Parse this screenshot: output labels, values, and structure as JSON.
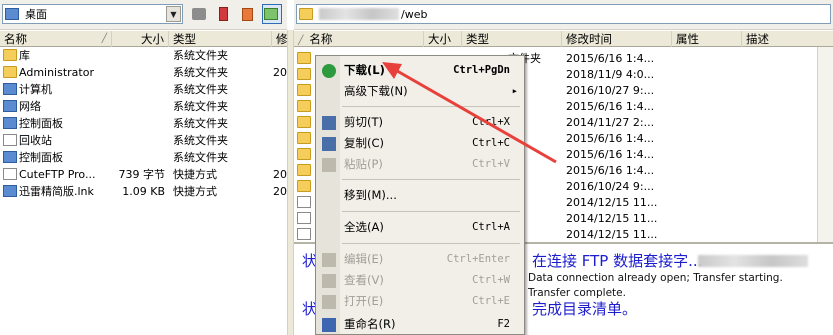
{
  "local_toolbar": {
    "path": "桌面"
  },
  "remote_toolbar": {
    "path_suffix": "/web"
  },
  "local_headers": [
    "名称",
    "大小",
    "类型",
    "修"
  ],
  "remote_headers": [
    "名称",
    "大小",
    "类型",
    "修改时间",
    "属性",
    "描述"
  ],
  "local_items": [
    {
      "name": "库",
      "size": "",
      "type": "系统文件夹",
      "mod": "",
      "icon": "folder"
    },
    {
      "name": "Administrator",
      "size": "",
      "type": "系统文件夹",
      "mod": "20",
      "icon": "folder"
    },
    {
      "name": "计算机",
      "size": "",
      "type": "系统文件夹",
      "mod": "",
      "icon": "blue"
    },
    {
      "name": "网络",
      "size": "",
      "type": "系统文件夹",
      "mod": "",
      "icon": "blue"
    },
    {
      "name": "控制面板",
      "size": "",
      "type": "系统文件夹",
      "mod": "",
      "icon": "blue"
    },
    {
      "name": "回收站",
      "size": "",
      "type": "系统文件夹",
      "mod": "",
      "icon": "file"
    },
    {
      "name": "控制面板",
      "size": "",
      "type": "系统文件夹",
      "mod": "",
      "icon": "blue"
    },
    {
      "name": "CuteFTP Pro...",
      "size": "739 字节",
      "type": "快捷方式",
      "mod": "20",
      "icon": "file"
    },
    {
      "name": "迅雷精简版.lnk",
      "size": "1.09 KB",
      "type": "快捷方式",
      "mod": "20",
      "icon": "blue"
    }
  ],
  "remote_items": [
    {
      "type": "文件夹",
      "mod": "2015/6/16 1:4...",
      "icon": "folder"
    },
    {
      "type": "",
      "mod": "2018/11/9 4:0...",
      "icon": "folder"
    },
    {
      "type": "",
      "mod": "2016/10/27 9:...",
      "icon": "folder"
    },
    {
      "type": "",
      "mod": "2015/6/16 1:4...",
      "icon": "folder"
    },
    {
      "type": "",
      "mod": "2014/11/27 2:...",
      "icon": "folder"
    },
    {
      "type": "",
      "mod": "2015/6/16 1:4...",
      "icon": "folder"
    },
    {
      "type": "",
      "mod": "2015/6/16 1:4...",
      "icon": "folder"
    },
    {
      "type": "",
      "mod": "2015/6/16 1:4...",
      "icon": "folder"
    },
    {
      "type": "",
      "mod": "2016/10/24 9:...",
      "icon": "folder"
    },
    {
      "type": "",
      "mod": "2014/12/15 11...",
      "icon": "file"
    },
    {
      "type": "",
      "mod": "2014/12/15 11...",
      "icon": "file"
    },
    {
      "type": "",
      "mod": "2014/12/15 11...",
      "icon": "file"
    }
  ],
  "log": {
    "line1_prefix": "状",
    "line1": "在连接 FTP 数据套接字...",
    "line2": "Data connection already open; Transfer starting.",
    "line3": "Transfer complete.",
    "line4_prefix": "状",
    "line4": "完成目录清单。"
  },
  "context_menu": [
    {
      "label": "下载(L)",
      "shortcut": "Ctrl+PgDn",
      "enabled": true,
      "bold": true,
      "icon": "download-icon"
    },
    {
      "label": "高级下载(N)",
      "shortcut": "",
      "enabled": true,
      "submenu": true
    },
    {
      "label": "剪切(T)",
      "shortcut": "Ctrl+X",
      "enabled": true,
      "icon": "cut-icon"
    },
    {
      "label": "复制(C)",
      "shortcut": "Ctrl+C",
      "enabled": true,
      "icon": "copy-icon"
    },
    {
      "label": "粘贴(P)",
      "shortcut": "Ctrl+V",
      "enabled": false,
      "icon": "paste-icon"
    },
    {
      "label": "移到(M)...",
      "shortcut": "",
      "enabled": true
    },
    {
      "label": "全选(A)",
      "shortcut": "Ctrl+A",
      "enabled": true
    },
    {
      "label": "编辑(E)",
      "shortcut": "Ctrl+Enter",
      "enabled": false,
      "icon": "edit-icon"
    },
    {
      "label": "查看(V)",
      "shortcut": "Ctrl+W",
      "enabled": false,
      "icon": "view-icon"
    },
    {
      "label": "打开(E)",
      "shortcut": "Ctrl+E",
      "enabled": false,
      "icon": "open-icon"
    },
    {
      "label": "重命名(R)",
      "shortcut": "F2",
      "enabled": true,
      "icon": "rename-icon"
    }
  ],
  "colors": {
    "arrow": "#e8403a",
    "log_text": "#1d1dcf"
  }
}
